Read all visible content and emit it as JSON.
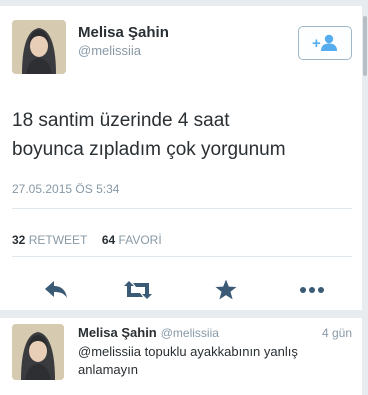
{
  "main_tweet": {
    "display_name": "Melisa Şahin",
    "handle": "@melissiia",
    "text_line1": "18 santim üzerinde 4 saat",
    "text_line2": "boyunca zıpladım çok yorgunum",
    "timestamp": "27.05.2015 ÖS 5:34",
    "retweet_count": "32",
    "retweet_label": "RETWEET",
    "favorite_count": "64",
    "favorite_label": "FAVORİ",
    "follow_icon": "add-user-icon"
  },
  "actions": {
    "reply_icon": "reply-icon",
    "retweet_icon": "retweet-icon",
    "favorite_icon": "star-icon",
    "more_icon": "more-icon"
  },
  "reply_tweet": {
    "display_name": "Melisa Şahin",
    "handle": "@melissiia",
    "time": "4 gün",
    "text_line1": "@melissiia topuklu ayakkabının yanlış",
    "text_line2": "anlamayın"
  },
  "colors": {
    "accent": "#55acee",
    "text": "#292f33",
    "muted": "#8899a6",
    "icon": "#3b5a75"
  }
}
